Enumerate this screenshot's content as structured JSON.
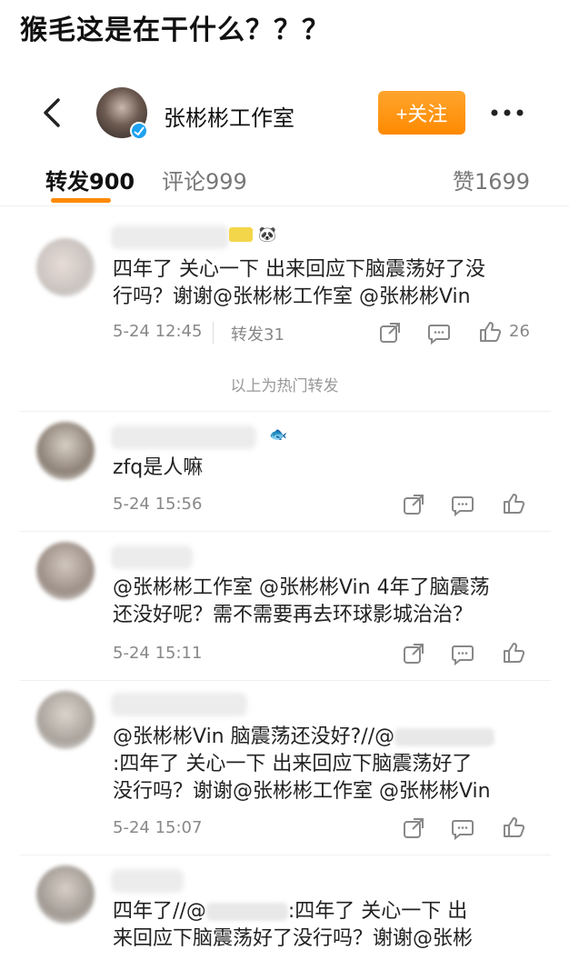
{
  "caption": "猴毛这是在干什么？？？",
  "header": {
    "account_name": "张彬彬工作室",
    "follow_label": "+关注"
  },
  "tabs": {
    "repost": "转发900",
    "comment": "评论999",
    "like": "赞1699"
  },
  "hot_section_label": "以上为热门转发",
  "posts": [
    {
      "text_lines": [
        "四年了 关心一下 出来回应下脑震荡好了没",
        "行吗？谢谢@张彬彬工作室 @张彬彬Vin"
      ],
      "time": "5-24 12:45",
      "repost": "转发31",
      "likes": "26"
    },
    {
      "text_lines": [
        "zfq是人嘛"
      ],
      "time": "5-24 15:56"
    },
    {
      "text_lines": [
        "@张彬彬工作室 @张彬彬Vin 4年了脑震荡",
        "还没好呢？需不需要再去环球影城治治？"
      ],
      "time": "5-24 15:11"
    },
    {
      "text_lines": [
        "@张彬彬Vin 脑震荡还没好?//@",
        ":四年了 关心一下 出来回应下脑震荡好了",
        "没行吗？谢谢@张彬彬工作室 @张彬彬Vin"
      ],
      "time": "5-24 15:07"
    },
    {
      "text_lines": [
        "四年了//@",
        ":四年了 关心一下 出",
        "来回应下脑震荡好了没行吗？谢谢@张彬"
      ]
    }
  ],
  "icons": [
    "back-icon",
    "verified-icon",
    "more-icon",
    "share-icon",
    "comment-icon",
    "like-icon"
  ],
  "colors": {
    "accent": "#ff8a00",
    "mention": "#3f68a6",
    "verified": "#1da1f2"
  }
}
